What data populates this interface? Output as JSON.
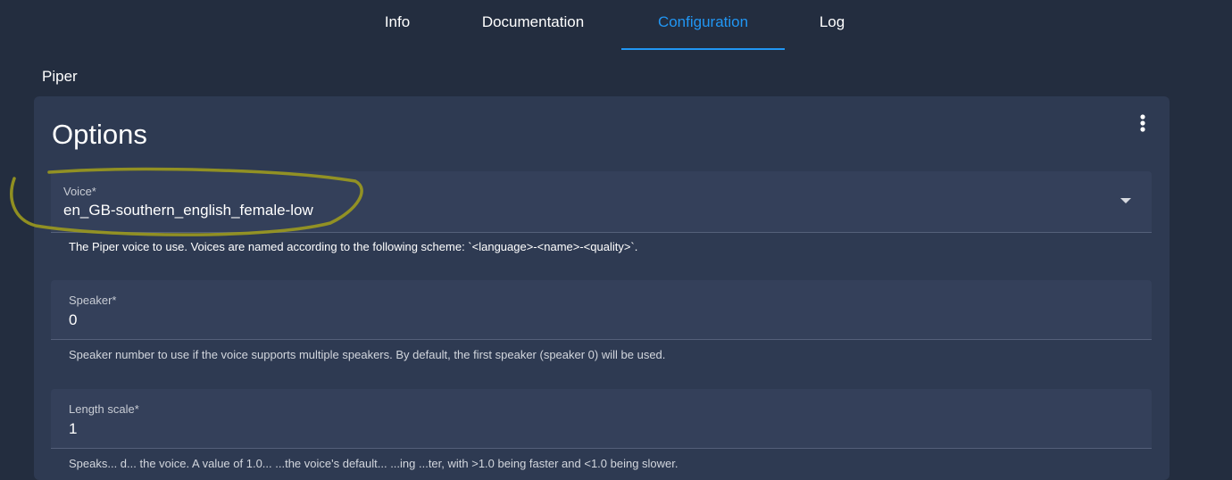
{
  "tabs": [
    {
      "label": "Info"
    },
    {
      "label": "Documentation"
    },
    {
      "label": "Configuration",
      "active": true
    },
    {
      "label": "Log"
    }
  ],
  "addon": {
    "name": "Piper"
  },
  "options": {
    "title": "Options",
    "menu_icon": "more-vertical-icon",
    "fields": [
      {
        "label": "Voice*",
        "value": "en_GB-southern_english_female-low",
        "type": "select",
        "helper": "The Piper voice to use. Voices are named according to the following scheme: `<language>-<name>-<quality>`."
      },
      {
        "label": "Speaker*",
        "value": "0",
        "type": "number",
        "helper": "Speaker number to use if the voice supports multiple speakers. By default, the first speaker (speaker 0) will be used."
      },
      {
        "label": "Length scale*",
        "value": "1",
        "type": "number",
        "helper": "Speaks... d... the voice. A value of 1.0... ...the voice's default... ...ing ...ter, with >1.0 being faster and <1.0 being slower."
      }
    ]
  },
  "colors": {
    "accent": "#2196f3",
    "background": "#232d3f",
    "card": "#2e3a52",
    "field": "#34405a",
    "annotation": "#9c9a1e"
  }
}
